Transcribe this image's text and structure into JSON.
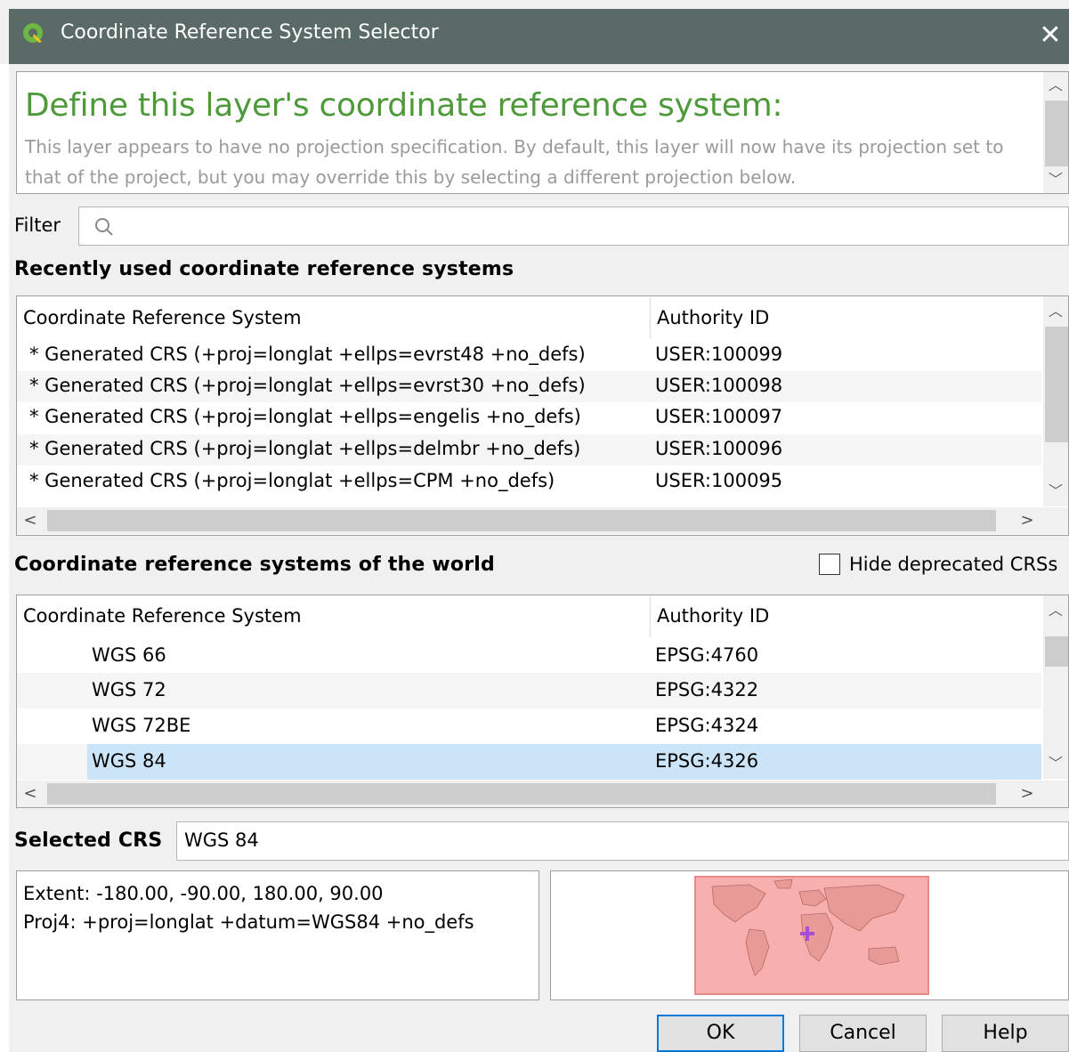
{
  "window": {
    "title": "Coordinate Reference System Selector",
    "close_glyph": "✕"
  },
  "message": {
    "heading": "Define this layer's coordinate reference system:",
    "body": "This layer appears to have no projection specification. By default, this layer will now have its projection set to that of the project, but you may override this by selecting a different projection below."
  },
  "filter": {
    "label": "Filter",
    "value": "",
    "icon": "search-icon"
  },
  "recent": {
    "title": "Recently used coordinate reference systems",
    "headers": [
      "Coordinate Reference System",
      "Authority ID"
    ],
    "rows": [
      {
        "name": "* Generated CRS (+proj=longlat +ellps=evrst48 +no_defs)",
        "id": "USER:100099"
      },
      {
        "name": "* Generated CRS (+proj=longlat +ellps=evrst30 +no_defs)",
        "id": "USER:100098"
      },
      {
        "name": "* Generated CRS (+proj=longlat +ellps=engelis +no_defs)",
        "id": "USER:100097"
      },
      {
        "name": "* Generated CRS (+proj=longlat +ellps=delmbr +no_defs)",
        "id": "USER:100096"
      },
      {
        "name": "* Generated CRS (+proj=longlat +ellps=CPM +no_defs)",
        "id": "USER:100095"
      }
    ]
  },
  "world": {
    "title": "Coordinate reference systems of the world",
    "hide_deprecated_label": "Hide deprecated CRSs",
    "hide_deprecated_checked": false,
    "headers": [
      "Coordinate Reference System",
      "Authority ID"
    ],
    "rows": [
      {
        "name": "WGS 66",
        "id": "EPSG:4760"
      },
      {
        "name": "WGS 72",
        "id": "EPSG:4322"
      },
      {
        "name": "WGS 72BE",
        "id": "EPSG:4324"
      },
      {
        "name": "WGS 84",
        "id": "EPSG:4326",
        "selected": true
      }
    ]
  },
  "selected": {
    "label": "Selected CRS",
    "value": "WGS 84",
    "extent": "Extent: -180.00, -90.00, 180.00, 90.00",
    "proj4": "Proj4: +proj=longlat +datum=WGS84 +no_defs"
  },
  "buttons": {
    "ok": "OK",
    "cancel": "Cancel",
    "help": "Help"
  },
  "colors": {
    "heading_green": "#4e9a3a",
    "titlebar": "#5a6a66",
    "selection": "#cce4f7",
    "extent_fill": "#f5a8a8",
    "marker": "#a64dd6"
  }
}
